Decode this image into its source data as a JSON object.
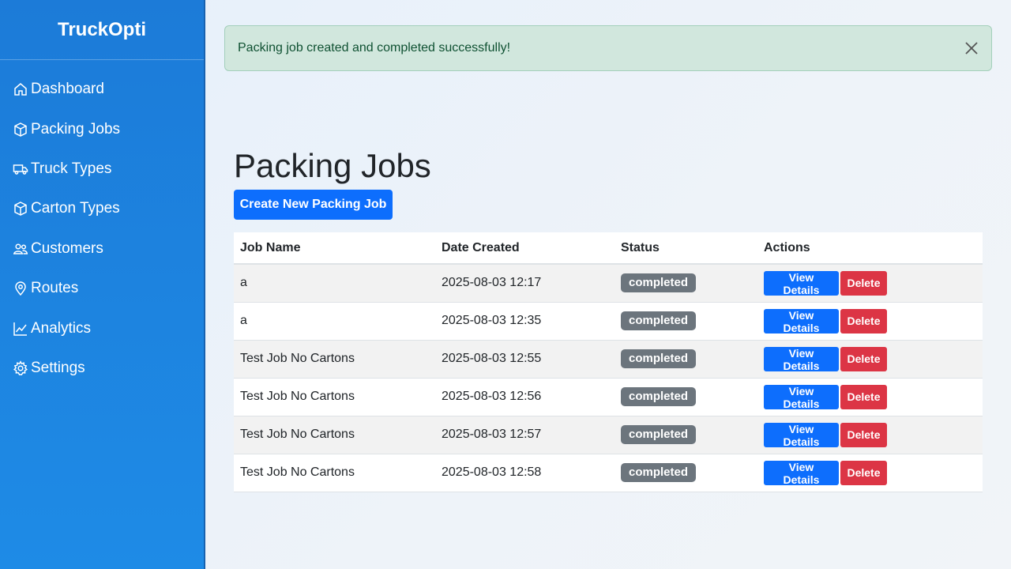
{
  "app": {
    "brand": "TruckOpti"
  },
  "sidebar": {
    "items": [
      {
        "label": "Dashboard",
        "icon": "house-icon"
      },
      {
        "label": "Packing Jobs",
        "icon": "box-icon"
      },
      {
        "label": "Truck Types",
        "icon": "truck-icon"
      },
      {
        "label": "Carton Types",
        "icon": "box-icon"
      },
      {
        "label": "Customers",
        "icon": "people-icon"
      },
      {
        "label": "Routes",
        "icon": "map-pin-icon"
      },
      {
        "label": "Analytics",
        "icon": "line-chart-icon"
      },
      {
        "label": "Settings",
        "icon": "gear-icon"
      }
    ]
  },
  "alert": {
    "message": "Packing job created and completed successfully!",
    "close_icon": "close-icon"
  },
  "main": {
    "title": "Packing Jobs",
    "create_button": "Create New Packing Job",
    "table": {
      "headers": [
        "Job Name",
        "Date Created",
        "Status",
        "Actions"
      ],
      "view_label": "View Details",
      "delete_label": "Delete",
      "rows": [
        {
          "name": "a",
          "date": "2025-08-03 12:17",
          "status": "completed"
        },
        {
          "name": "a",
          "date": "2025-08-03 12:35",
          "status": "completed"
        },
        {
          "name": "Test Job No Cartons",
          "date": "2025-08-03 12:55",
          "status": "completed"
        },
        {
          "name": "Test Job No Cartons",
          "date": "2025-08-03 12:56",
          "status": "completed"
        },
        {
          "name": "Test Job No Cartons",
          "date": "2025-08-03 12:57",
          "status": "completed"
        },
        {
          "name": "Test Job No Cartons",
          "date": "2025-08-03 12:58",
          "status": "completed"
        }
      ]
    }
  },
  "colors": {
    "sidebar": "#1e88e5",
    "primary": "#0d6efd",
    "danger": "#dc3545",
    "badge": "#6c757d",
    "alert_bg": "#d1e7dd"
  }
}
